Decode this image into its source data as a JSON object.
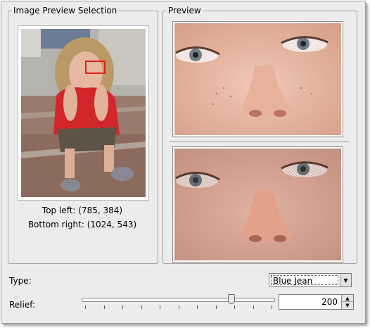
{
  "selection_group": {
    "title": "Image Preview Selection",
    "top_left": "Top left: (785, 384)",
    "bottom_right": "Bottom right: (1024, 543)"
  },
  "preview_group": {
    "title": "Preview"
  },
  "controls": {
    "type_label": "Type:",
    "type_value": "Blue Jean",
    "relief_label": "Relief:",
    "relief_value": "200",
    "relief_slider_fraction": 0.78
  },
  "icons": {
    "combo_arrow": "chevron-down-icon",
    "spin_up": "chevron-up-icon",
    "spin_down": "chevron-down-icon"
  },
  "colors": {
    "selection_box": "#e0201a"
  }
}
